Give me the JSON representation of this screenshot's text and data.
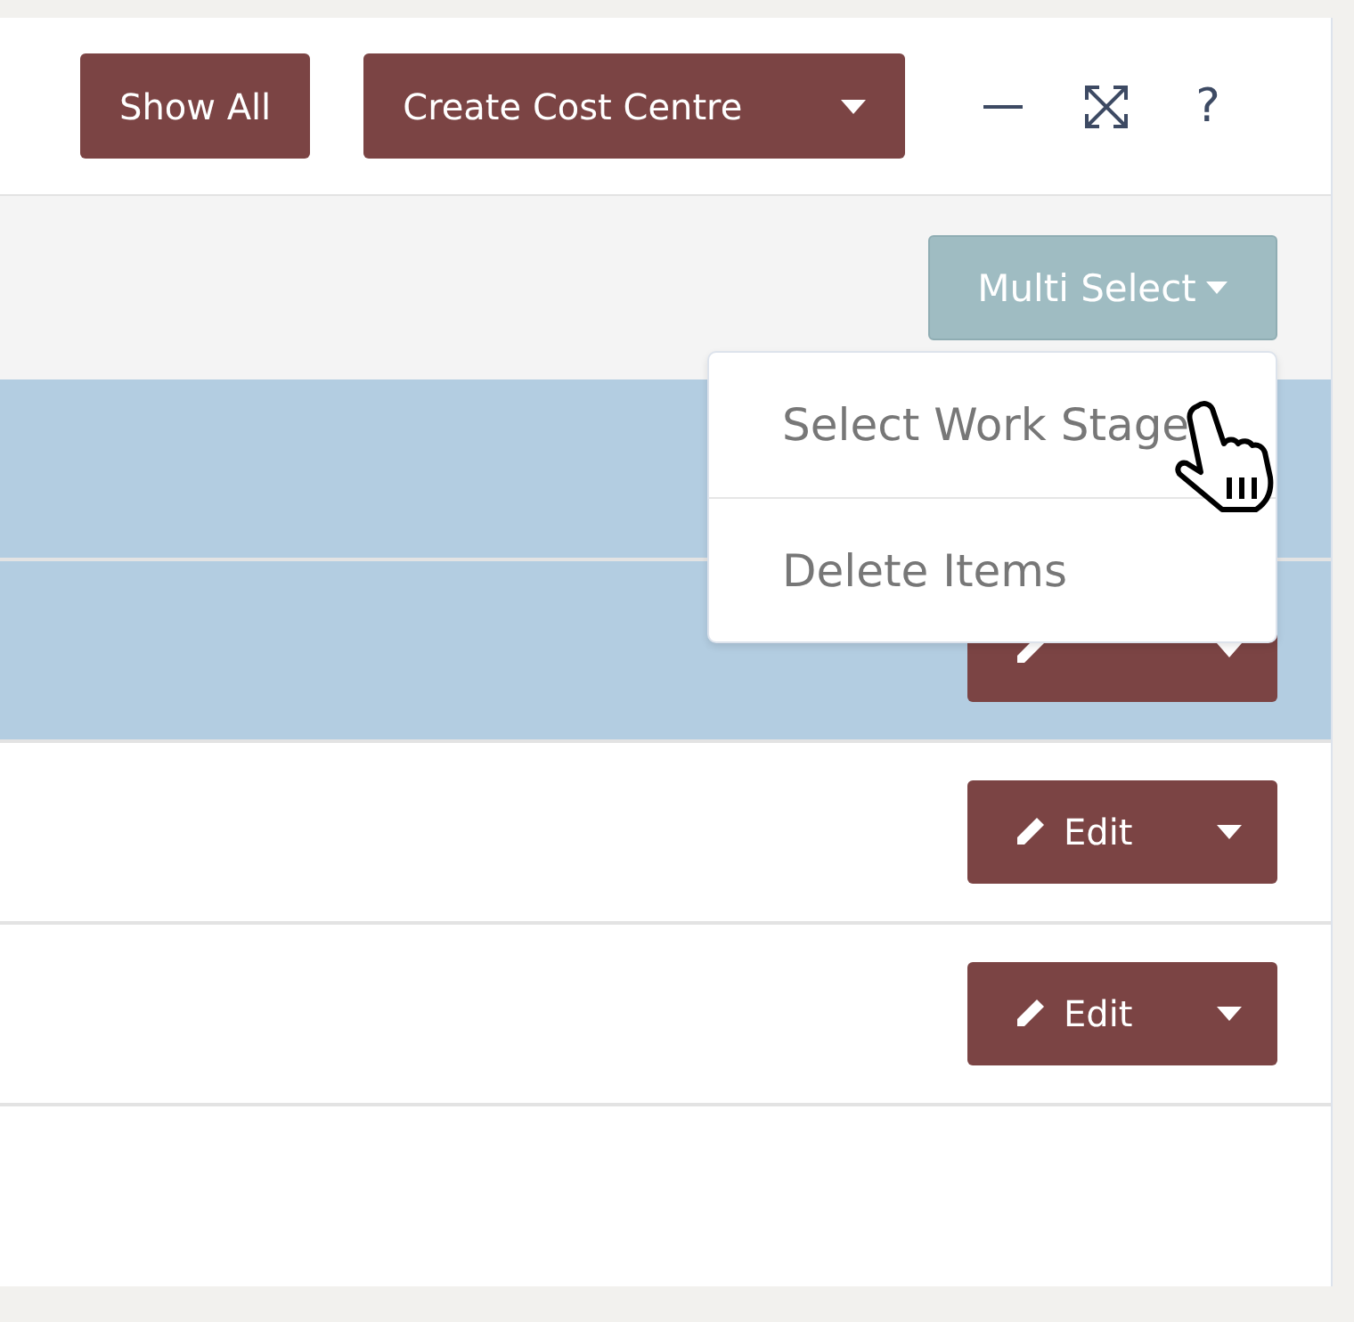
{
  "header": {
    "buttons": [
      {
        "label": "Show All",
        "kind": "plain"
      },
      {
        "label": "Create Cost Centre",
        "kind": "split"
      }
    ],
    "help": "?"
  },
  "toolbar": {
    "multi_select": "Multi Select"
  },
  "menu": {
    "items": [
      "Select Work Stage",
      "Delete Items"
    ]
  },
  "rows": [
    {
      "selected": true
    },
    {
      "selected": true,
      "has_edit": true
    },
    {
      "selected": false,
      "has_edit": true,
      "action": "Edit"
    },
    {
      "selected": false,
      "has_edit": true,
      "action": "Edit"
    }
  ]
}
